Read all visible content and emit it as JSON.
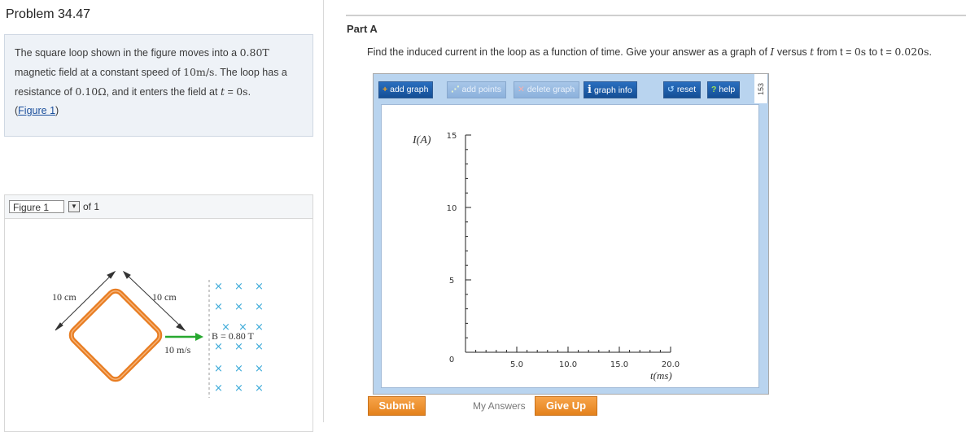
{
  "problem": {
    "title": "Problem 34.47",
    "statement": {
      "line1": {
        "a": "The square loop shown in the figure moves into a ",
        "b": "0.80",
        "c": "T"
      },
      "line2": {
        "a": "magnetic field at a constant speed of ",
        "b": "10",
        "c": "m/s",
        "d": ". The loop has a"
      },
      "line3": {
        "a": "resistance of ",
        "b": "0.10",
        "c": "Ω",
        "d": ", and it enters the field at ",
        "e": "t",
        "f": " = ",
        "g": "0",
        "h": "s",
        "i": "."
      },
      "link_open": "(",
      "link_text": "Figure 1",
      "link_close": ")"
    }
  },
  "figure_panel": {
    "selected": "Figure 1",
    "of_text": "of 1",
    "labels": {
      "side_left": "10 cm",
      "side_right": "10 cm",
      "field": "B = 0.80 T",
      "speed": "10 m/s",
      "field_mark": "×"
    },
    "colors": {
      "loop": "#e87d22",
      "arrow": "#27a82f",
      "field": "#3aa9d8"
    }
  },
  "part": {
    "label": "Part A",
    "question": {
      "a": "Find the induced current in the loop as a function of time. Give your answer as a graph of ",
      "b": "I",
      "c": " versus ",
      "d": "t",
      "e": " from t = ",
      "f": "0",
      "g": "s",
      "h": " to t = ",
      "i": "0.020",
      "j": "s",
      "k": "."
    }
  },
  "toolbar": {
    "add_graph": "add graph",
    "add_points": "add points",
    "delete_graph": "delete graph",
    "graph_info": "graph info",
    "reset": "reset",
    "help": "help",
    "timer": "153"
  },
  "graph": {
    "y_axis_label": "I(A)",
    "x_axis_label": "t(ms)",
    "y_ticks": [
      "15",
      "10",
      "5",
      "0"
    ],
    "x_ticks": [
      "5.0",
      "10.0",
      "15.0",
      "20.0"
    ]
  },
  "actions": {
    "submit": "Submit",
    "my_answers": "My Answers",
    "give_up": "Give Up"
  },
  "colors": {
    "statement_bg": "#eef2f7",
    "tool_bg": "#b9d4ef",
    "button_blue": "#1e5fa8",
    "button_orange": "#f29a35"
  }
}
